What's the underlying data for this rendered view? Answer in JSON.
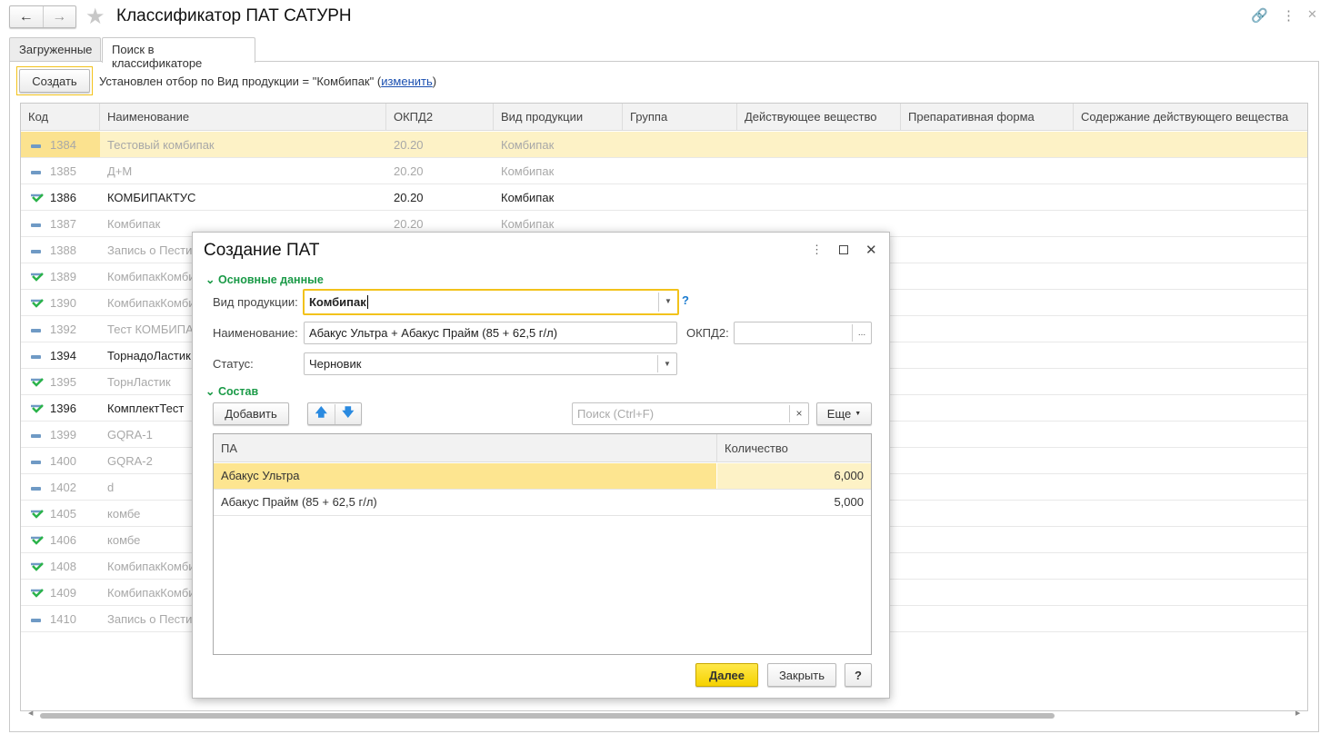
{
  "window": {
    "title": "Классификатор ПАТ САТУРН",
    "back_icon": "arrow-left",
    "forward_icon": "arrow-right",
    "star_icon": "star"
  },
  "tabs": [
    {
      "label": "Загруженные",
      "active": false
    },
    {
      "label": "Поиск в классификаторе",
      "active": true
    }
  ],
  "toolbar": {
    "create_label": "Создать",
    "filter_text": "Установлен отбор по Вид продукции = \"Комбипак\" (",
    "filter_link": "изменить",
    "filter_close": ")"
  },
  "table": {
    "columns": [
      "Код",
      "Наименование",
      "ОКПД2",
      "Вид продукции",
      "Группа",
      "Действующее вещество",
      "Препаративная форма",
      "Содержание действующего вещества"
    ],
    "rows": [
      {
        "code": "1384",
        "name": "Тестовый комбипак",
        "okpd": "20.20",
        "vid": "Комбипак",
        "icon": "minus",
        "active": false,
        "selected": true
      },
      {
        "code": "1385",
        "name": "Д+М",
        "okpd": "20.20",
        "vid": "Комбипак",
        "icon": "minus",
        "active": false
      },
      {
        "code": "1386",
        "name": "КОМБИПАКТУС",
        "okpd": "20.20",
        "vid": "Комбипак",
        "icon": "check",
        "active": true
      },
      {
        "code": "1387",
        "name": "Комбипак",
        "okpd": "20.20",
        "vid": "Комбипак",
        "icon": "minus",
        "active": false
      },
      {
        "code": "1388",
        "name": " Запись о Пести",
        "icon": "minus",
        "active": false
      },
      {
        "code": "1389",
        "name": "КомбипакКомби",
        "icon": "check",
        "active": false
      },
      {
        "code": "1390",
        "name": "КомбипакКомби",
        "icon": "check",
        "active": false
      },
      {
        "code": "1392",
        "name": "Тест КОМБИПА",
        "icon": "minus",
        "active": false
      },
      {
        "code": "1394",
        "name": "ТорнадоЛастик",
        "icon": "minus",
        "active": true
      },
      {
        "code": "1395",
        "name": "ТорнЛастик",
        "icon": "check",
        "active": false
      },
      {
        "code": "1396",
        "name": "КомплектТест",
        "icon": "check",
        "active": true
      },
      {
        "code": "1399",
        "name": "GQRA-1",
        "icon": "minus",
        "active": false
      },
      {
        "code": "1400",
        "name": "GQRA-2",
        "icon": "minus",
        "active": false
      },
      {
        "code": "1402",
        "name": "d",
        "icon": "minus",
        "active": false
      },
      {
        "code": "1405",
        "name": "комбе",
        "icon": "check",
        "active": false
      },
      {
        "code": "1406",
        "name": "комбе",
        "icon": "check",
        "active": false
      },
      {
        "code": "1408",
        "name": "КомбипакКомби",
        "icon": "check",
        "active": false
      },
      {
        "code": "1409",
        "name": "КомбипакКомби",
        "icon": "check",
        "active": false
      },
      {
        "code": "1410",
        "name": " Запись о Пести",
        "icon": "minus",
        "active": false
      }
    ]
  },
  "dialog": {
    "title": "Создание ПАТ",
    "group_main": "Основные данные",
    "vid_label": "Вид продукции:",
    "vid_value": "Комбипак",
    "help": "?",
    "name_label": "Наименование:",
    "name_value": "Абакус Ультра + Абакус Прайм (85 + 62,5 г/л)",
    "okpd_label": "ОКПД2:",
    "okpd_value": "",
    "okpd_btn": "...",
    "status_label": "Статус:",
    "status_value": "Черновик",
    "group_comp": "Состав",
    "add_label": "Добавить",
    "search_placeholder": "Поиск (Ctrl+F)",
    "search_clear": "×",
    "more_label": "Еще",
    "columns": [
      "ПА",
      "Количество"
    ],
    "rows": [
      {
        "pa": "Абакус Ультра",
        "qty": "6,000",
        "selected": true
      },
      {
        "pa": "Абакус Прайм (85 + 62,5 г/л)",
        "qty": "5,000"
      }
    ],
    "next_label": "Далее",
    "close_label": "Закрыть",
    "help_btn": "?"
  },
  "colors": {
    "accent_yellow": "#f5d800",
    "focus": "#f2c21b",
    "group_green": "#1a9a47",
    "selected_row": "#fdf2c6"
  }
}
